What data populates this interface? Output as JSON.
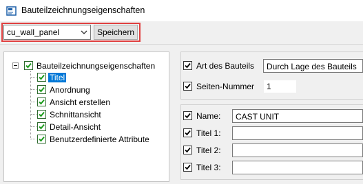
{
  "window": {
    "title": "Bauteilzeichnungseigenschaften",
    "icon": "drawing-properties-icon"
  },
  "toolbar": {
    "preset_value": "cu_wall_panel",
    "save_label": "Speichern"
  },
  "tree": {
    "root": {
      "label": "Bauteilzeichnungseigenschaften",
      "checked": true,
      "expanded": true
    },
    "children": [
      {
        "label": "Titel",
        "checked": true,
        "selected": true
      },
      {
        "label": "Anordnung",
        "checked": true
      },
      {
        "label": "Ansicht erstellen",
        "checked": true
      },
      {
        "label": "Schnittansicht",
        "checked": true
      },
      {
        "label": "Detail-Ansicht",
        "checked": true
      },
      {
        "label": "Benutzerdefinierte Attribute",
        "checked": true
      }
    ]
  },
  "properties": {
    "art": {
      "label": "Art des Bauteils",
      "checked": true,
      "value": "Durch Lage des Bauteils"
    },
    "seiten": {
      "label": "Seiten-Nummer",
      "checked": true,
      "value": "1"
    },
    "name": {
      "label": "Name:",
      "checked": true,
      "value": "CAST UNIT"
    },
    "titel1": {
      "label": "Titel 1:",
      "checked": true,
      "value": ""
    },
    "titel2": {
      "label": "Titel 2:",
      "checked": true,
      "value": ""
    },
    "titel3": {
      "label": "Titel 3:",
      "checked": true,
      "value": ""
    }
  },
  "colors": {
    "highlight_border": "#e04040",
    "selection": "#0078d7",
    "tree_check": "#1a9b1a"
  }
}
